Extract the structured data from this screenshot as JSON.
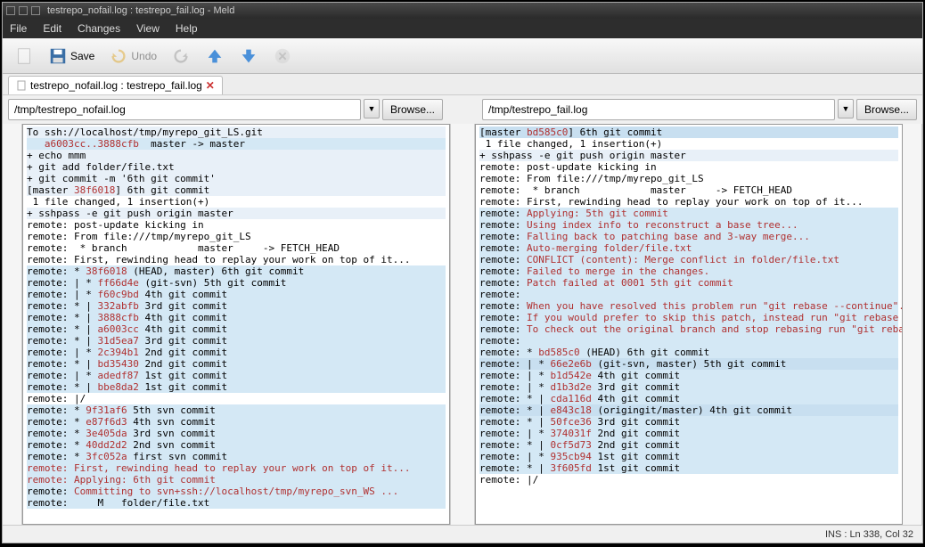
{
  "title": "testrepo_nofail.log : testrepo_fail.log - Meld",
  "menu": {
    "file": "File",
    "edit": "Edit",
    "changes": "Changes",
    "view": "View",
    "help": "Help"
  },
  "toolbar": {
    "save": "Save",
    "undo": "Undo"
  },
  "tab": {
    "label": "testrepo_nofail.log : testrepo_fail.log"
  },
  "paths": {
    "left": "/tmp/testrepo_nofail.log",
    "right": "/tmp/testrepo_fail.log",
    "browse": "Browse..."
  },
  "status": "INS : Ln 338, Col 32",
  "left_lines": [
    {
      "t": "To ssh://localhost/tmp/myrepo_git_LS.git",
      "cls": "hl-ltblue"
    },
    {
      "t": "   a6003cc..3888cfb  master -> master",
      "cls": "hl-blue",
      "arrow": "right",
      "red": [
        3,
        20
      ]
    },
    {
      "t": "+ echo mmm",
      "cls": "hl-ltblue"
    },
    {
      "t": "+ git add folder/file.txt",
      "cls": "hl-ltblue"
    },
    {
      "t": "+ git commit -m '6th git commit'",
      "cls": "hl-ltblue"
    },
    {
      "t": "[master 38f6018] 6th git commit",
      "cls": "hl-ltblue",
      "arrow": "right",
      "red": [
        8,
        15
      ]
    },
    {
      "t": " 1 file changed, 1 insertion(+)",
      "cls": ""
    },
    {
      "t": "+ sshpass -e git push origin master",
      "cls": "hl-ltblue"
    },
    {
      "t": "remote: post-update kicking in",
      "cls": ""
    },
    {
      "t": "remote: From file:///tmp/myrepo_git_LS",
      "cls": ""
    },
    {
      "t": "remote:  * branch            master     -> FETCH_HEAD",
      "cls": ""
    },
    {
      "t": "remote: First, rewinding head to replay your work on top of it...",
      "cls": ""
    },
    {
      "t": "remote: * 38f6018 (HEAD, master) 6th git commit",
      "cls": "hl-blue",
      "arrow": "right",
      "red": [
        10,
        17
      ]
    },
    {
      "t": "remote: | * ff66d4e (git-svn) 5th git commit",
      "cls": "hl-blue",
      "red": [
        12,
        19
      ]
    },
    {
      "t": "remote: | * f60c9bd 4th git commit",
      "cls": "hl-blue",
      "red": [
        12,
        19
      ]
    },
    {
      "t": "remote: * | 332abfb 3rd git commit",
      "cls": "hl-blue",
      "red": [
        12,
        19
      ]
    },
    {
      "t": "remote: * | 3888cfb 4th git commit",
      "cls": "hl-blue",
      "red": [
        12,
        19
      ]
    },
    {
      "t": "remote: * | a6003cc 4th git commit",
      "cls": "hl-blue",
      "red": [
        12,
        19
      ]
    },
    {
      "t": "remote: * | 31d5ea7 3rd git commit",
      "cls": "hl-blue",
      "red": [
        12,
        19
      ]
    },
    {
      "t": "remote: | * 2c394b1 2nd git commit",
      "cls": "hl-blue",
      "red": [
        12,
        19
      ]
    },
    {
      "t": "remote: * | bd35430 2nd git commit",
      "cls": "hl-blue",
      "red": [
        12,
        19
      ]
    },
    {
      "t": "remote: | * adedf87 1st git commit",
      "cls": "hl-blue",
      "red": [
        12,
        19
      ]
    },
    {
      "t": "remote: * | bbe8da2 1st git commit",
      "cls": "hl-blue",
      "red": [
        12,
        19
      ]
    },
    {
      "t": "remote: |/",
      "cls": ""
    },
    {
      "t": "remote: * 9f31af6 5th svn commit",
      "cls": "hl-blue",
      "arrow": "right",
      "red": [
        10,
        17
      ]
    },
    {
      "t": "remote: * e87f6d3 4th svn commit",
      "cls": "hl-blue",
      "red": [
        10,
        17
      ]
    },
    {
      "t": "remote: * 3e405da 3rd svn commit",
      "cls": "hl-blue",
      "red": [
        10,
        17
      ]
    },
    {
      "t": "remote: * 40dd2d2 2nd svn commit",
      "cls": "hl-blue",
      "red": [
        10,
        17
      ]
    },
    {
      "t": "remote: * 3fc052a first svn commit",
      "cls": "hl-blue",
      "red": [
        10,
        17
      ]
    },
    {
      "t": "remote: First, rewinding head to replay your work on top of it...",
      "cls": "hl-blue",
      "allred": true
    },
    {
      "t": "remote: Applying: 6th git commit",
      "cls": "hl-blue",
      "allred": true
    },
    {
      "t": "remote: Committing to svn+ssh://localhost/tmp/myrepo_svn_WS ...",
      "cls": "hl-blue",
      "allred": true,
      "redprefix": 8
    },
    {
      "t": "remote:     M   folder/file.txt",
      "cls": "hl-blue"
    }
  ],
  "right_lines": [
    {
      "t": "[master bd585c0] 6th git commit",
      "cls": "hl-diff",
      "arrow": "left",
      "red": [
        8,
        15
      ]
    },
    {
      "t": " 1 file changed, 1 insertion(+)",
      "cls": ""
    },
    {
      "t": "+ sshpass -e git push origin master",
      "cls": "hl-ltblue"
    },
    {
      "t": "remote: post-update kicking in",
      "cls": ""
    },
    {
      "t": "remote: From file:///tmp/myrepo_git_LS",
      "cls": ""
    },
    {
      "t": "remote:  * branch            master     -> FETCH_HEAD",
      "cls": ""
    },
    {
      "t": "remote: First, rewinding head to replay your work on top of it...",
      "cls": ""
    },
    {
      "t": "remote: Applying: 5th git commit",
      "cls": "hl-blue",
      "arrow": "left",
      "allred": true,
      "redprefix": 8
    },
    {
      "t": "remote: Using index info to reconstruct a base tree...",
      "cls": "hl-blue",
      "allred": true,
      "redprefix": 8
    },
    {
      "t": "remote: Falling back to patching base and 3-way merge...",
      "cls": "hl-blue",
      "allred": true,
      "redprefix": 8
    },
    {
      "t": "remote: Auto-merging folder/file.txt",
      "cls": "hl-blue",
      "allred": true,
      "redprefix": 8
    },
    {
      "t": "remote: CONFLICT (content): Merge conflict in folder/file.txt",
      "cls": "hl-blue",
      "allred": true,
      "redprefix": 8
    },
    {
      "t": "remote: Failed to merge in the changes.",
      "cls": "hl-blue",
      "allred": true,
      "redprefix": 8
    },
    {
      "t": "remote: Patch failed at 0001 5th git commit",
      "cls": "hl-blue",
      "allred": true,
      "redprefix": 8
    },
    {
      "t": "remote:",
      "cls": "hl-blue",
      "allred": true,
      "redprefix": 8
    },
    {
      "t": "remote: When you have resolved this problem run \"git rebase --continue\".",
      "cls": "hl-blue",
      "allred": true,
      "redprefix": 8
    },
    {
      "t": "remote: If you would prefer to skip this patch, instead run \"git rebase --skip\".",
      "cls": "hl-blue",
      "allred": true,
      "redprefix": 8
    },
    {
      "t": "remote: To check out the original branch and stop rebasing run \"git rebase --abort\".",
      "cls": "hl-blue",
      "allred": true,
      "redprefix": 8
    },
    {
      "t": "remote:",
      "cls": "hl-blue",
      "allred": true,
      "redprefix": 8
    },
    {
      "t": "remote: * bd585c0 (HEAD) 6th git commit",
      "cls": "hl-blue",
      "red": [
        10,
        17
      ]
    },
    {
      "t": "remote: | * 66e2e6b (git-svn, master) 5th git commit",
      "cls": "hl-diff",
      "red": [
        12,
        19
      ]
    },
    {
      "t": "remote: | * b1d542e 4th git commit",
      "cls": "hl-blue",
      "red": [
        12,
        19
      ]
    },
    {
      "t": "remote: | * d1b3d2e 3rd git commit",
      "cls": "hl-blue",
      "red": [
        12,
        19
      ]
    },
    {
      "t": "remote: * | cda116d 4th git commit",
      "cls": "hl-blue",
      "red": [
        12,
        19
      ]
    },
    {
      "t": "remote: * | e843c18 (origingit/master) 4th git commit",
      "cls": "hl-diff",
      "red": [
        12,
        19
      ]
    },
    {
      "t": "remote: * | 50fce36 3rd git commit",
      "cls": "hl-blue",
      "red": [
        12,
        19
      ]
    },
    {
      "t": "remote: | * 374031f 2nd git commit",
      "cls": "hl-blue",
      "red": [
        12,
        19
      ]
    },
    {
      "t": "remote: * | 0cf5d73 2nd git commit",
      "cls": "hl-blue",
      "red": [
        12,
        19
      ]
    },
    {
      "t": "remote: | * 935cb94 1st git commit",
      "cls": "hl-blue",
      "red": [
        12,
        19
      ]
    },
    {
      "t": "remote: * | 3f605fd 1st git commit",
      "cls": "hl-blue",
      "red": [
        12,
        19
      ]
    },
    {
      "t": "remote: |/",
      "cls": ""
    },
    {
      "t": "",
      "cls": ""
    }
  ]
}
